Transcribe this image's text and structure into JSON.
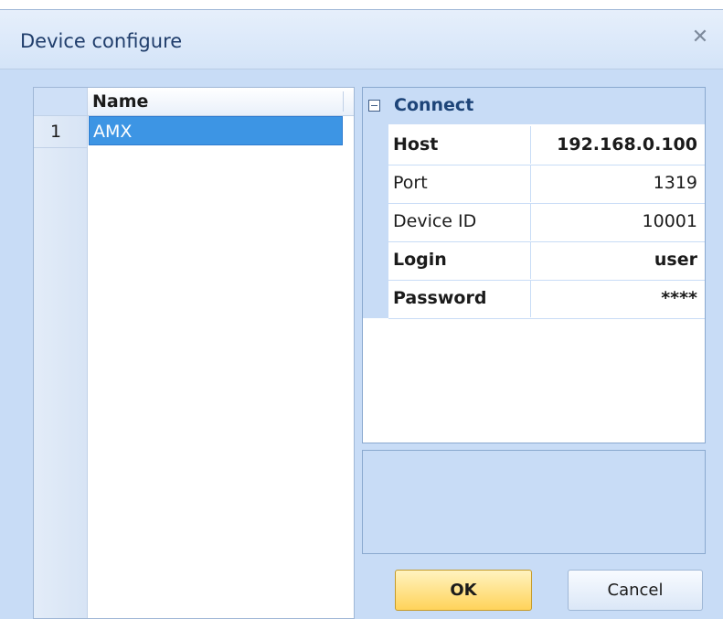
{
  "window": {
    "title": "Device configure"
  },
  "grid": {
    "column_header": "Name",
    "rows": [
      {
        "num": "1",
        "name": "AMX"
      }
    ]
  },
  "props": {
    "category": "Connect",
    "rows": [
      {
        "name": "Host",
        "value": "192.168.0.100",
        "bold": true
      },
      {
        "name": "Port",
        "value": "1319",
        "bold": false
      },
      {
        "name": "Device ID",
        "value": "10001",
        "bold": false
      },
      {
        "name": "Login",
        "value": "user",
        "bold": true
      },
      {
        "name": "Password",
        "value": "****",
        "bold": true
      }
    ]
  },
  "buttons": {
    "ok": "OK",
    "cancel": "Cancel"
  },
  "icons": {
    "close": "close-icon",
    "collapse": "minus-box-icon"
  }
}
